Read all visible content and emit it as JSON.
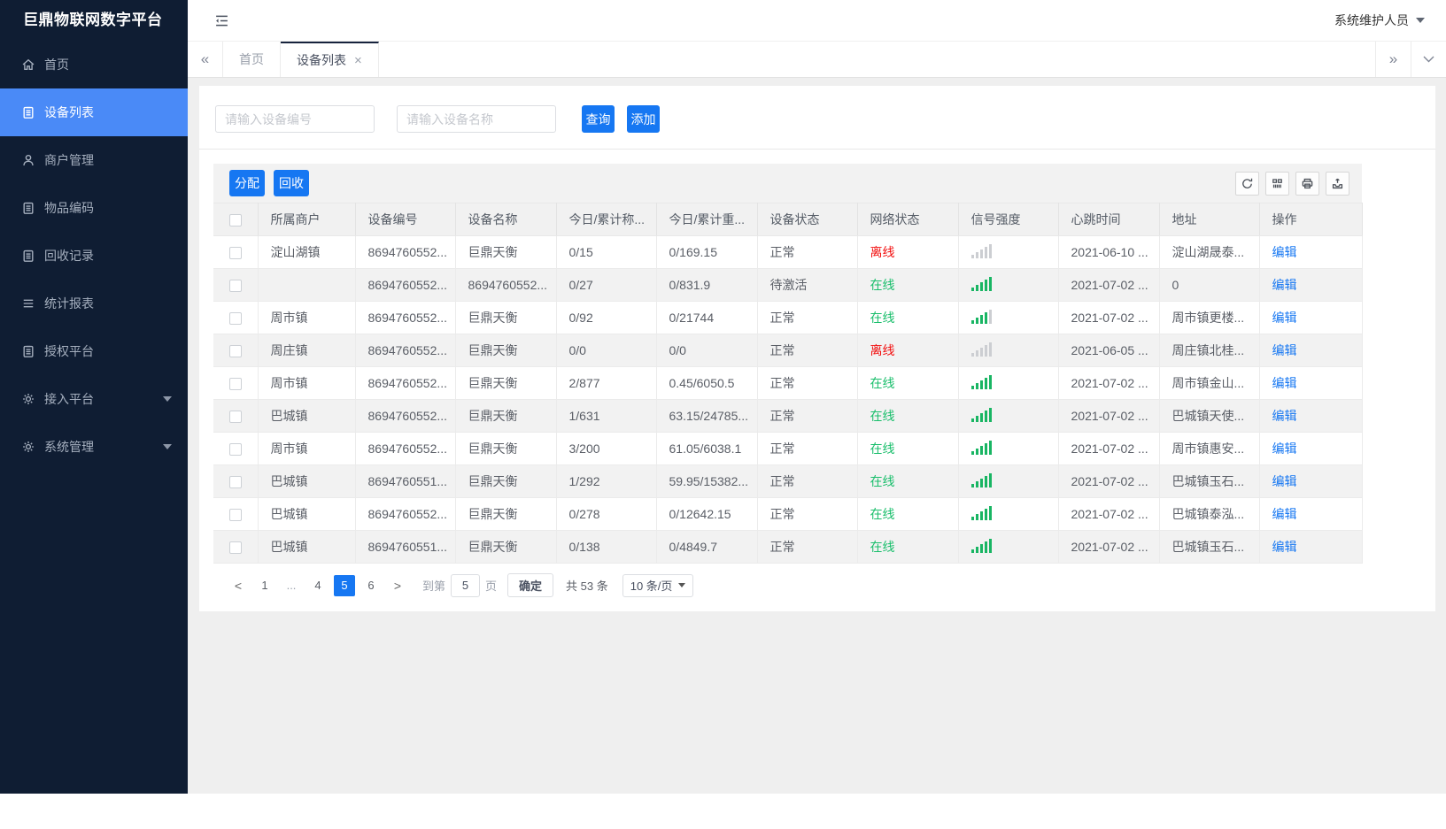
{
  "app": {
    "title": "巨鼎物联网数字平台",
    "user": "系统维护人员"
  },
  "sidebar": {
    "items": [
      {
        "id": "home",
        "label": "首页",
        "icon": "home"
      },
      {
        "id": "device-list",
        "label": "设备列表",
        "icon": "clipboard",
        "active": true
      },
      {
        "id": "merchant-mgmt",
        "label": "商户管理",
        "icon": "user"
      },
      {
        "id": "item-code",
        "label": "物品编码",
        "icon": "clipboard"
      },
      {
        "id": "recycle-record",
        "label": "回收记录",
        "icon": "clipboard"
      },
      {
        "id": "stats-report",
        "label": "统计报表",
        "icon": "list"
      },
      {
        "id": "auth-platform",
        "label": "授权平台",
        "icon": "clipboard"
      },
      {
        "id": "access-platform",
        "label": "接入平台",
        "icon": "gear",
        "caret": true
      },
      {
        "id": "system-mgmt",
        "label": "系统管理",
        "icon": "gear",
        "caret": true
      }
    ]
  },
  "tabbar": {
    "scroll_left": "«",
    "scroll_right": "»",
    "close_glyph": "×",
    "tabs": [
      {
        "label": "首页"
      },
      {
        "label": "设备列表",
        "active": true,
        "closable": true
      }
    ]
  },
  "search": {
    "device_no_placeholder": "请输入设备编号",
    "device_name_placeholder": "请输入设备名称",
    "query_label": "查询",
    "add_label": "添加"
  },
  "toolbar": {
    "assign_label": "分配",
    "recycle_label": "回收",
    "icon_buttons": [
      "refresh",
      "columns",
      "print",
      "export"
    ]
  },
  "table": {
    "columns": [
      "所属商户",
      "设备编号",
      "设备名称",
      "今日/累计称...",
      "今日/累计重...",
      "设备状态",
      "网络状态",
      "信号强度",
      "心跳时间",
      "地址",
      "操作"
    ],
    "edit_label": "编辑",
    "rows": [
      {
        "merchant": "淀山湖镇",
        "device_no": "8694760552...",
        "device_name": "巨鼎天衡",
        "today_count": "0/15",
        "today_weight": "0/169.15",
        "device_status": "正常",
        "network_status": "离线",
        "online": false,
        "signal": 0,
        "heartbeat": "2021-06-10 ...",
        "address": "淀山湖晟泰..."
      },
      {
        "merchant": "",
        "device_no": "8694760552...",
        "device_name": "8694760552...",
        "today_count": "0/27",
        "today_weight": "0/831.9",
        "device_status": "待激活",
        "network_status": "在线",
        "online": true,
        "signal": 5,
        "heartbeat": "2021-07-02 ...",
        "address": "0"
      },
      {
        "merchant": "周市镇",
        "device_no": "8694760552...",
        "device_name": "巨鼎天衡",
        "today_count": "0/92",
        "today_weight": "0/21744",
        "device_status": "正常",
        "network_status": "在线",
        "online": true,
        "signal": 4,
        "heartbeat": "2021-07-02 ...",
        "address": "周市镇更楼..."
      },
      {
        "merchant": "周庄镇",
        "device_no": "8694760552...",
        "device_name": "巨鼎天衡",
        "today_count": "0/0",
        "today_weight": "0/0",
        "device_status": "正常",
        "network_status": "离线",
        "online": false,
        "signal": 0,
        "heartbeat": "2021-06-05 ...",
        "address": "周庄镇北桂..."
      },
      {
        "merchant": "周市镇",
        "device_no": "8694760552...",
        "device_name": "巨鼎天衡",
        "today_count": "2/877",
        "today_weight": "0.45/6050.5",
        "device_status": "正常",
        "network_status": "在线",
        "online": true,
        "signal": 5,
        "heartbeat": "2021-07-02 ...",
        "address": "周市镇金山..."
      },
      {
        "merchant": "巴城镇",
        "device_no": "8694760552...",
        "device_name": "巨鼎天衡",
        "today_count": "1/631",
        "today_weight": "63.15/24785...",
        "device_status": "正常",
        "network_status": "在线",
        "online": true,
        "signal": 5,
        "heartbeat": "2021-07-02 ...",
        "address": "巴城镇天使..."
      },
      {
        "merchant": "周市镇",
        "device_no": "8694760552...",
        "device_name": "巨鼎天衡",
        "today_count": "3/200",
        "today_weight": "61.05/6038.1",
        "device_status": "正常",
        "network_status": "在线",
        "online": true,
        "signal": 5,
        "heartbeat": "2021-07-02 ...",
        "address": "周市镇惠安..."
      },
      {
        "merchant": "巴城镇",
        "device_no": "8694760551...",
        "device_name": "巨鼎天衡",
        "today_count": "1/292",
        "today_weight": "59.95/15382...",
        "device_status": "正常",
        "network_status": "在线",
        "online": true,
        "signal": 5,
        "heartbeat": "2021-07-02 ...",
        "address": "巴城镇玉石..."
      },
      {
        "merchant": "巴城镇",
        "device_no": "8694760552...",
        "device_name": "巨鼎天衡",
        "today_count": "0/278",
        "today_weight": "0/12642.15",
        "device_status": "正常",
        "network_status": "在线",
        "online": true,
        "signal": 5,
        "heartbeat": "2021-07-02 ...",
        "address": "巴城镇泰泓..."
      },
      {
        "merchant": "巴城镇",
        "device_no": "8694760551...",
        "device_name": "巨鼎天衡",
        "today_count": "0/138",
        "today_weight": "0/4849.7",
        "device_status": "正常",
        "network_status": "在线",
        "online": true,
        "signal": 5,
        "heartbeat": "2021-07-02 ...",
        "address": "巴城镇玉石..."
      }
    ]
  },
  "pagination": {
    "prev": "<",
    "next": ">",
    "pages": [
      "1",
      "...",
      "4",
      "5",
      "6"
    ],
    "active_page": "5",
    "goto_label": "到第",
    "goto_value": "5",
    "unit_label": "页",
    "confirm_label": "确定",
    "total_label": "共 53 条",
    "page_size_label": "10 条/页"
  }
}
